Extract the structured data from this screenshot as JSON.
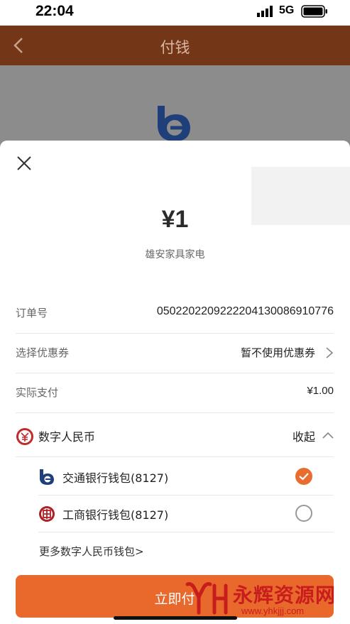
{
  "status_bar": {
    "time": "22:04",
    "network": "5G"
  },
  "nav": {
    "title": "付钱"
  },
  "payment": {
    "amount": "¥1",
    "merchant": "雄安家具家电"
  },
  "rows": {
    "order": {
      "label": "订单号",
      "value": "050220220922220413008691077​6"
    },
    "coupon": {
      "label": "选择优惠券",
      "value": "暂不使用优惠券"
    },
    "actual": {
      "label": "实际支付",
      "value": "¥1.00"
    }
  },
  "ecny": {
    "label": "数字人民币",
    "collapse": "收起"
  },
  "wallets": [
    {
      "label": "交通银行钱包(8127)",
      "selected": true,
      "icon": "bocom-logo-icon"
    },
    {
      "label": "工商银行钱包(8127)",
      "selected": false,
      "icon": "icbc-logo-icon"
    }
  ],
  "more_wallets": "更多数字人民币钱包>",
  "pay_button": {
    "label": "立即付"
  },
  "watermark": {
    "text": "永辉资源网",
    "url": "www.yhkjjj.com"
  },
  "colors": {
    "nav_bg": "#733717",
    "accent": "#e9692d",
    "bocom_blue": "#1f3f7a",
    "icbc_red": "#b01f24"
  }
}
